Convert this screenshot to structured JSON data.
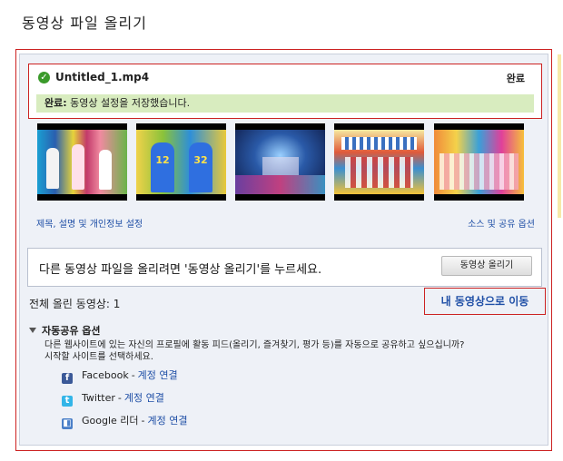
{
  "page": {
    "title": "동영상 파일 올리기"
  },
  "upload_item": {
    "file_name": "Untitled_1.mp4",
    "status": "완료",
    "message_bold": "완료:",
    "message": "동영상 설정을 저장했습니다.",
    "settings_link": "제목, 설명 및 개인정보 설정",
    "share_link": "소스 및 공유 옵션"
  },
  "upload_more": {
    "text": "다른 동영상 파일을 올리려면 '동영상 올리기'를 누르세요.",
    "button": "동영상 올리기"
  },
  "summary": {
    "total": "전체 올린 동영상: 1",
    "my_videos_link": "내 동영상으로 이동"
  },
  "autoshare": {
    "title": "자동공유 옵션",
    "desc1": "다른 웹사이트에 있는 자신의 프로필에 활동 피드(올리기, 즐겨찾기, 평가 등)를 자동으로 공유하고 싶으십니까?",
    "desc2": "시작할 사이트를 선택하세요.",
    "services": [
      {
        "name": "Facebook",
        "link": "계정 연결",
        "icon": "facebook-icon"
      },
      {
        "name": "Twitter",
        "link": "계정 연결",
        "icon": "twitter-icon"
      },
      {
        "name": "Google 리더",
        "link": "계정 연결",
        "icon": "google-reader-icon"
      }
    ]
  },
  "colors": {
    "highlight_border": "#cc2222",
    "link": "#1f4fa6",
    "success_bg": "#d8ecbf"
  }
}
